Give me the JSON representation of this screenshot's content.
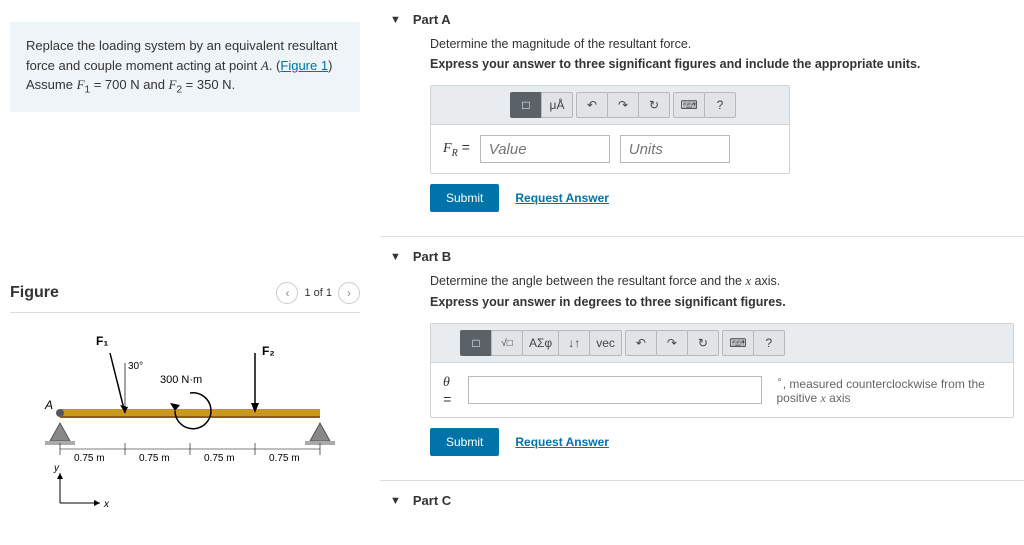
{
  "problem": {
    "prefix": "Replace the loading system by an equivalent resultant force and couple moment acting at point ",
    "pointVar": "A",
    "figLinkLabel": "Figure 1",
    "assume": "Assume ",
    "F1var": "F",
    "F1sub": "1",
    "F1val": " = 700 N",
    "and": " and ",
    "F2var": "F",
    "F2sub": "2",
    "F2val": " = 350 N",
    "suffix": "."
  },
  "figure": {
    "title": "Figure",
    "counter": "1 of 1",
    "labels": {
      "F1": "F₁",
      "F2": "F₂",
      "angle": "30°",
      "moment": "300 N·m",
      "A": "A",
      "d1": "0.75 m",
      "d2": "0.75 m",
      "d3": "0.75 m",
      "d4": "0.75 m",
      "x": "x",
      "y": "y"
    }
  },
  "partA": {
    "title": "Part A",
    "line1": "Determine the magnitude of the resultant force.",
    "line2": "Express your answer to three significant figures and include the appropriate units.",
    "var": "F",
    "sub": "R",
    "eq": " = ",
    "valuePh": "Value",
    "unitsPh": "Units",
    "submit": "Submit",
    "request": "Request Answer",
    "tools": {
      "tpl": "□",
      "ua": "μÅ",
      "undo": "↶",
      "redo": "↷",
      "reset": "↻",
      "kb": "⌨",
      "help": "?"
    }
  },
  "partB": {
    "title": "Part B",
    "line1prefix": "Determine the angle between the resultant force and the ",
    "line1var": "x",
    "line1suffix": " axis.",
    "line2": "Express your answer in degrees to three significant figures.",
    "var": "θ",
    "eq": " = ",
    "suffix_prefix": ", measured counterclockwise from the positive ",
    "suffix_var": "x",
    "suffix_end": " axis",
    "deg": "∘",
    "submit": "Submit",
    "request": "Request Answer",
    "tools": {
      "sq": "□",
      "root": "√□",
      "greek": "ΑΣφ",
      "arrows": "↓↑",
      "vec": "vec",
      "undo": "↶",
      "redo": "↷",
      "reset": "↻",
      "kb": "⌨",
      "help": "?"
    }
  },
  "partC": {
    "title": "Part C"
  }
}
